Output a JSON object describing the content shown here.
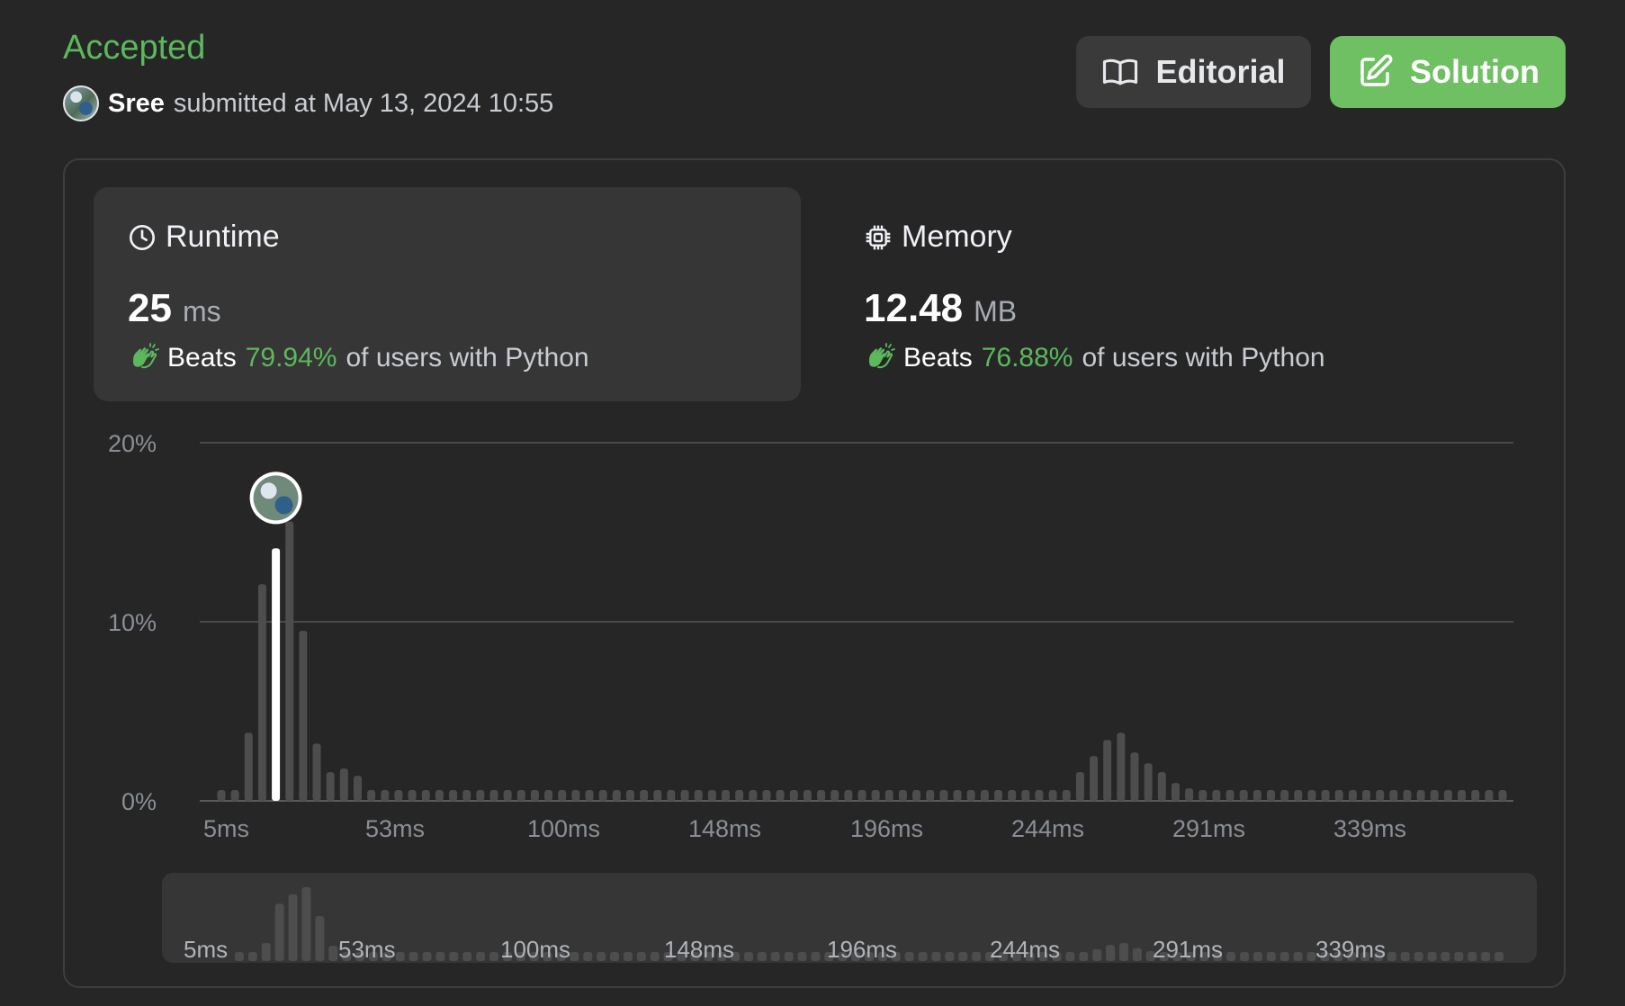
{
  "header": {
    "status": "Accepted",
    "user_name": "Sree",
    "submitted_text": "submitted at May 13, 2024 10:55"
  },
  "buttons": {
    "editorial_label": "Editorial",
    "solution_label": "Solution"
  },
  "runtime": {
    "title": "Runtime",
    "value": "25",
    "unit": "ms",
    "beats_label": "Beats",
    "beats_pct": "79.94%",
    "beats_suffix": "of users with Python"
  },
  "memory": {
    "title": "Memory",
    "value": "12.48",
    "unit": "MB",
    "beats_label": "Beats",
    "beats_pct": "76.88%",
    "beats_suffix": "of users with Python"
  },
  "colors": {
    "accepted": "#5cb85c",
    "solution_button": "#6fbf63",
    "bar": "#4d4d4d",
    "bar_selected": "#ffffff"
  },
  "icons": {
    "editorial": "book-open-icon",
    "solution": "edit-icon",
    "runtime": "clock-icon",
    "memory": "cpu-chip-icon",
    "beats": "clapping-hands-icon"
  },
  "chart_data": {
    "type": "bar",
    "ylim": [
      0,
      20
    ],
    "yticks": [
      "20%",
      "10%",
      "0%"
    ],
    "xtick_labels": [
      "5ms",
      "53ms",
      "100ms",
      "148ms",
      "196ms",
      "244ms",
      "291ms",
      "339ms"
    ],
    "selected_bar": 4,
    "values": [
      0.6,
      0.6,
      3.8,
      12.1,
      14.1,
      15.6,
      9.5,
      3.2,
      1.6,
      1.8,
      1.4,
      0.6,
      0.6,
      0.6,
      0.6,
      0.6,
      0.6,
      0.6,
      0.6,
      0.6,
      0.6,
      0.6,
      0.6,
      0.6,
      0.6,
      0.6,
      0.6,
      0.6,
      0.6,
      0.6,
      0.6,
      0.6,
      0.6,
      0.6,
      0.6,
      0.6,
      0.6,
      0.6,
      0.6,
      0.6,
      0.6,
      0.6,
      0.6,
      0.6,
      0.6,
      0.6,
      0.6,
      0.6,
      0.6,
      0.6,
      0.6,
      0.6,
      0.6,
      0.6,
      0.6,
      0.6,
      0.6,
      0.6,
      0.6,
      0.6,
      0.6,
      0.6,
      0.6,
      1.6,
      2.5,
      3.4,
      3.8,
      2.7,
      2.1,
      1.6,
      1.0,
      0.7,
      0.6,
      0.6,
      0.6,
      0.6,
      0.6,
      0.6,
      0.6,
      0.6,
      0.6,
      0.6,
      0.6,
      0.6,
      0.6,
      0.6,
      0.6,
      0.6,
      0.6,
      0.6,
      0.6,
      0.6,
      0.6,
      0.6,
      0.6
    ]
  }
}
